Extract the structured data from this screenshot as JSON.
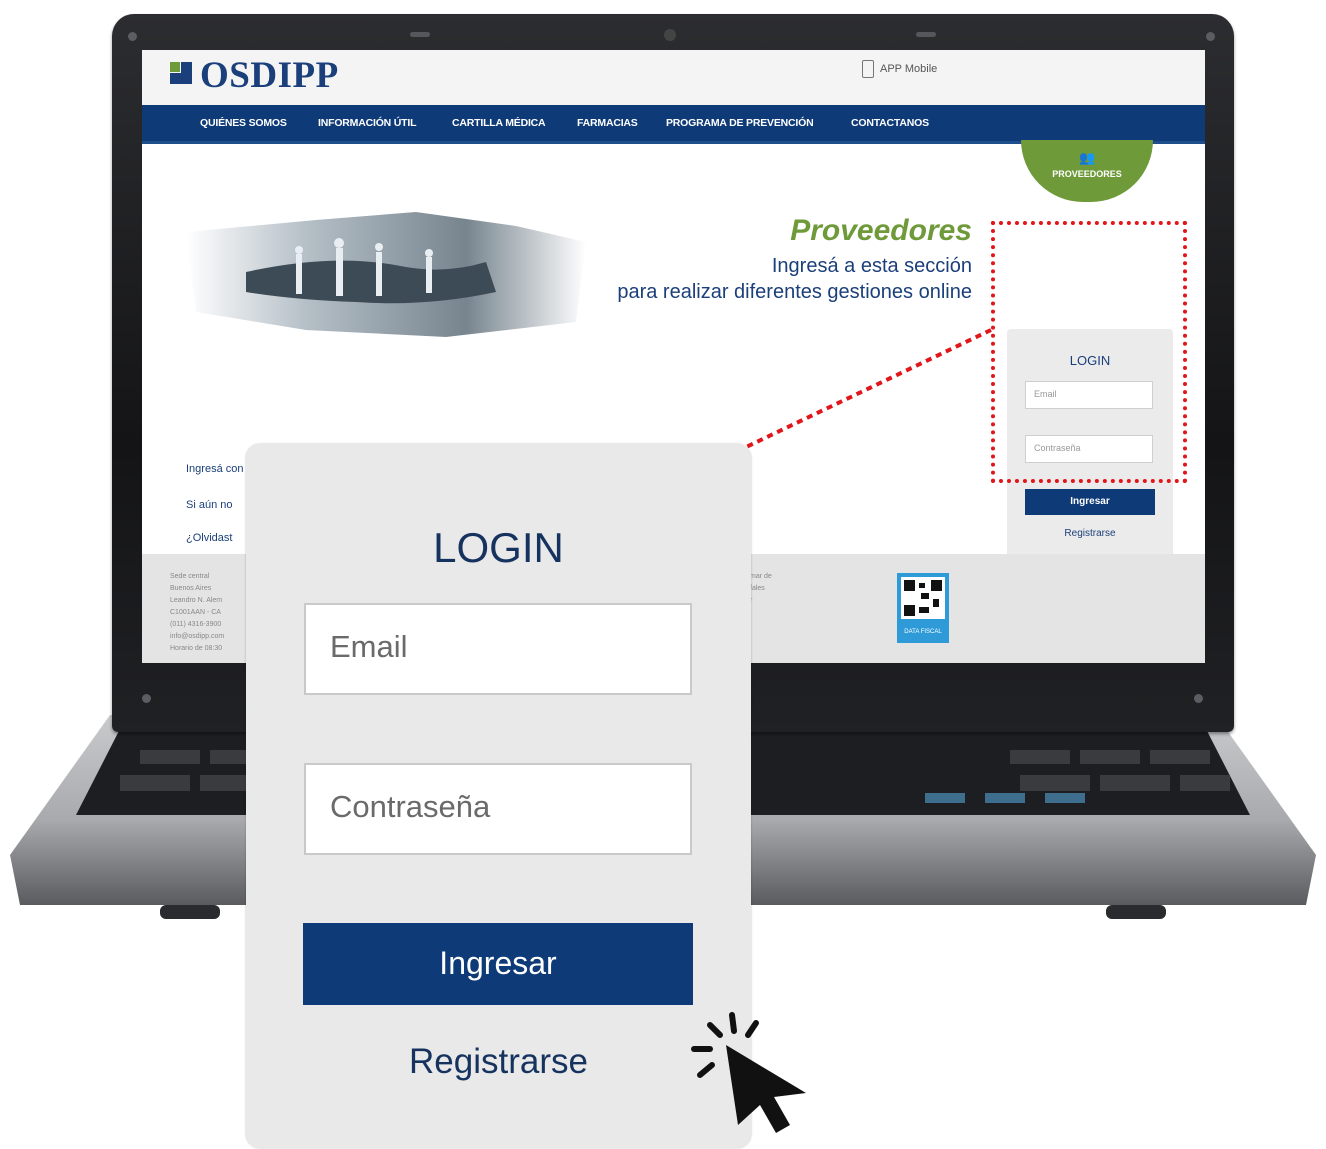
{
  "site": {
    "logo": "OSDIPP",
    "app_mobile": "APP Mobile",
    "nav": [
      "QUIÉNES SOMOS",
      "INFORMACIÓN ÚTIL",
      "CARTILLA MÉDICA",
      "FARMACIAS",
      "PROGRAMA DE PREVENCIÓN",
      "CONTACTANOS"
    ],
    "badge": {
      "icon": "people-icon",
      "label": "PROVEEDORES"
    },
    "hero": {
      "title": "Proveedores",
      "subtitle_line1": "Ingresá a esta sección",
      "subtitle_line2": "para realizar diferentes gestiones online"
    },
    "info": {
      "line1": "Ingresá con tu usuario y contraseña para acceder a esta información.",
      "line2": "Si aún no",
      "line3": "¿Olvidast"
    },
    "small_login": {
      "title": "LOGIN",
      "email_placeholder": "Email",
      "password_placeholder": "Contraseña",
      "submit": "Ingresar",
      "register": "Registrarse"
    },
    "footer": {
      "lines": [
        "Sede central",
        "Buenos Aires",
        "Leandro N. Alem",
        "C1001AAN - CA",
        "(011) 4316-3900",
        "info@osdipp.com",
        "Horario de 08:30"
      ],
      "mid_lines": [
        "mar de",
        "fales",
        "r"
      ],
      "qr_label": "DATA FISCAL"
    }
  },
  "zoom": {
    "title": "LOGIN",
    "email_placeholder": "Email",
    "password_placeholder": "Contraseña",
    "submit": "Ingresar",
    "register": "Registrarse"
  },
  "colors": {
    "brand_blue": "#0e3a78",
    "brand_green": "#6f9a3a",
    "highlight_red": "#e0161b"
  }
}
